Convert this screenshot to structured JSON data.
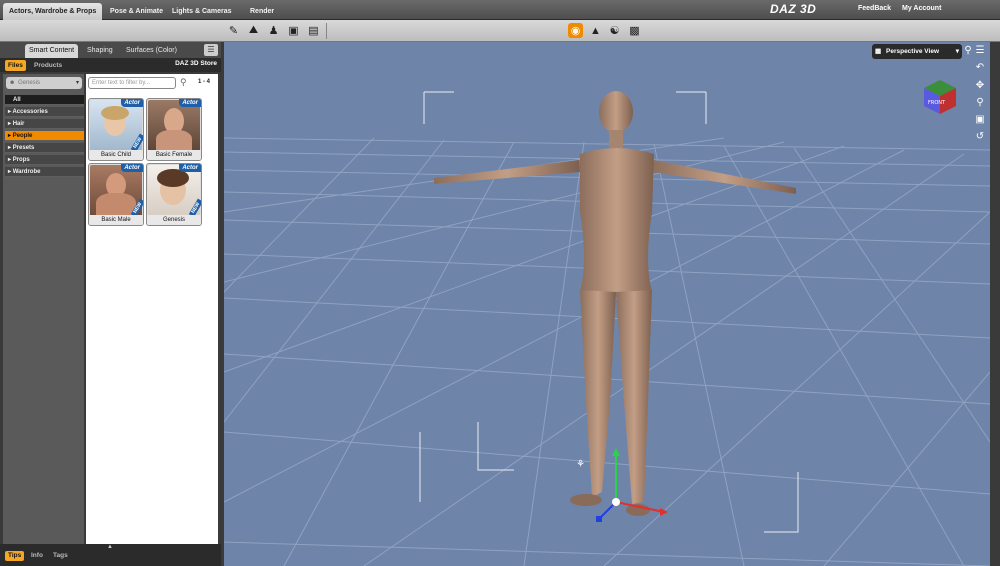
{
  "rooms": [
    "Actors, Wardrobe & Props",
    "Pose & Animate",
    "Lights & Cameras",
    "Render"
  ],
  "brand": "DAZ 3D",
  "links": {
    "feedback": "FeedBack",
    "account": "My Account"
  },
  "toolbar_icons": [
    "select-tool-icon",
    "scene-icon",
    "pose-icon",
    "universal-tool-icon",
    "node-tool-icon",
    "render-settings-icon",
    "geometry-icon",
    "figure-icon",
    "camera-icon"
  ],
  "panel": {
    "tabs": [
      "Smart Content",
      "Shaping",
      "Surfaces (Color)"
    ],
    "subtabs": [
      "Files",
      "Products"
    ],
    "store": "DAZ 3D Store",
    "figure_select": "Genesis",
    "categories": [
      "All",
      "Accessories",
      "Hair",
      "People",
      "Presets",
      "Props",
      "Wardrobe"
    ],
    "selected_category": "People",
    "filter_placeholder": "Enter text to filter by...",
    "count": "1 - 4",
    "items": [
      {
        "label": "Basic Child",
        "badge": "Actor",
        "new": "NEW"
      },
      {
        "label": "Basic Female",
        "badge": "Actor",
        "new": ""
      },
      {
        "label": "Basic Male",
        "badge": "Actor",
        "new": "NEW"
      },
      {
        "label": "Genesis",
        "badge": "Actor",
        "new": "NEW"
      }
    ],
    "bottom_tabs": [
      "Tips",
      "Info",
      "Tags"
    ]
  },
  "viewport": {
    "view": "Perspective View",
    "cube_label": "FRONT",
    "background": "#6e84a8"
  },
  "colors": {
    "accent": "#f08a00",
    "badge": "#1f5fa8"
  }
}
